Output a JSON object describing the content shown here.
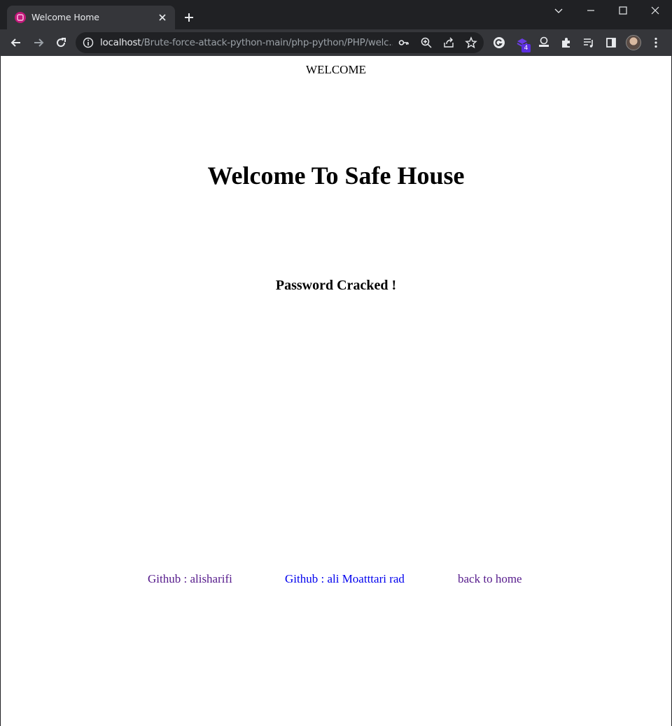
{
  "browser": {
    "tab": {
      "title": "Welcome Home"
    },
    "omnibox": {
      "url_host": "localhost",
      "url_path": "/Brute-force-attack-python-main/php-python/PHP/welc..."
    },
    "extension_badge": "4"
  },
  "page": {
    "top_label": "WELCOME",
    "heading": "Welcome To Safe House",
    "subheading": "Password Cracked !",
    "links": [
      {
        "label": "Github : alisharifi",
        "state": "visited"
      },
      {
        "label": "Github : ali Moatttari rad",
        "state": "unvisited"
      },
      {
        "label": "back to home",
        "state": "visited"
      }
    ]
  },
  "colors": {
    "link_visited": "#551a8b",
    "link_unvisited": "#0000ee",
    "chrome_dark": "#202124",
    "chrome_toolbar": "#35363a"
  }
}
